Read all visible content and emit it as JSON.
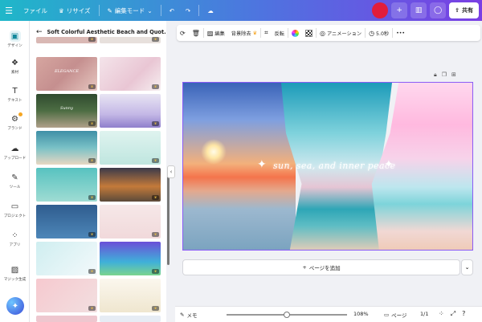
{
  "topbar": {
    "file": "ファイル",
    "resize": "リサイズ",
    "edit_mode": "編集モード",
    "share": "共有"
  },
  "rail": {
    "items": [
      "デザイン",
      "素材",
      "テキスト",
      "ブランド",
      "アップロード",
      "ツール",
      "プロジェクト",
      "アプリ",
      "マジック生成"
    ]
  },
  "panel": {
    "title": "Soft Colorful Aesthetic Beach and Quot...",
    "thumb_texts": [
      "ELEGANCE",
      "Sunny",
      "Paradise",
      ""
    ]
  },
  "context_toolbar": {
    "edit": "編集",
    "bg_remove": "背景除去",
    "flip": "反転",
    "animation": "アニメーション",
    "duration": "5.0秒"
  },
  "canvas": {
    "text": "sun, sea, and inner peace"
  },
  "add_page": "ページを追加",
  "bottombar": {
    "notes": "メモ",
    "zoom": "108%",
    "zoom_level": 0.5,
    "pages": "ページ",
    "page_count": "1/1"
  },
  "colors": {
    "topbar_start": "#1fb7c9",
    "topbar_end": "#7a3fe4",
    "selection": "#8b5cf6"
  }
}
